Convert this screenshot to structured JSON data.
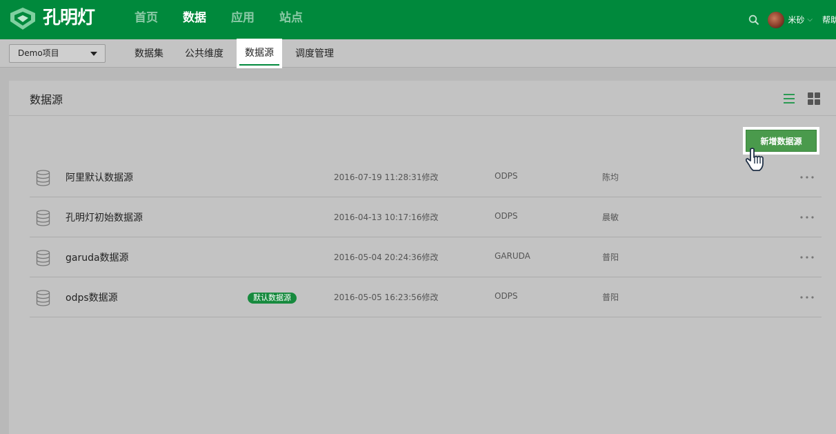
{
  "app": {
    "logo_text": "孔明灯",
    "nav": [
      {
        "label": "首页"
      },
      {
        "label": "数据"
      },
      {
        "label": "应用"
      },
      {
        "label": "站点"
      }
    ],
    "user": {
      "name": "米砂",
      "help": "帮助"
    }
  },
  "subbar": {
    "project": "Demo项目",
    "tabs": [
      {
        "label": "数据集"
      },
      {
        "label": "公共维度"
      },
      {
        "label": "数据源"
      },
      {
        "label": "调度管理"
      }
    ]
  },
  "panel": {
    "title": "数据源",
    "add_button": "新增数据源",
    "default_badge": "默认数据源",
    "rows": [
      {
        "name": "阿里默认数据源",
        "time": "2016-07-19 11:28:31修改",
        "type": "ODPS",
        "owner": "陈均"
      },
      {
        "name": "孔明灯初始数据源",
        "time": "2016-04-13 10:17:16修改",
        "type": "ODPS",
        "owner": "晨敏"
      },
      {
        "name": "garuda数据源",
        "time": "2016-05-04 20:24:36修改",
        "type": "GARUDA",
        "owner": "普阳"
      },
      {
        "name": "odps数据源",
        "time": "2016-05-05 16:23:56修改",
        "type": "ODPS",
        "owner": "普阳"
      }
    ]
  },
  "colors": {
    "brand": "#00893c",
    "badge": "#178a3e",
    "button": "#4a9a4c"
  },
  "icons": [
    "logo-icon",
    "search-icon",
    "chevron-down-icon",
    "list-view-icon",
    "grid-view-icon",
    "database-icon",
    "more-icon",
    "hand-cursor-icon"
  ]
}
